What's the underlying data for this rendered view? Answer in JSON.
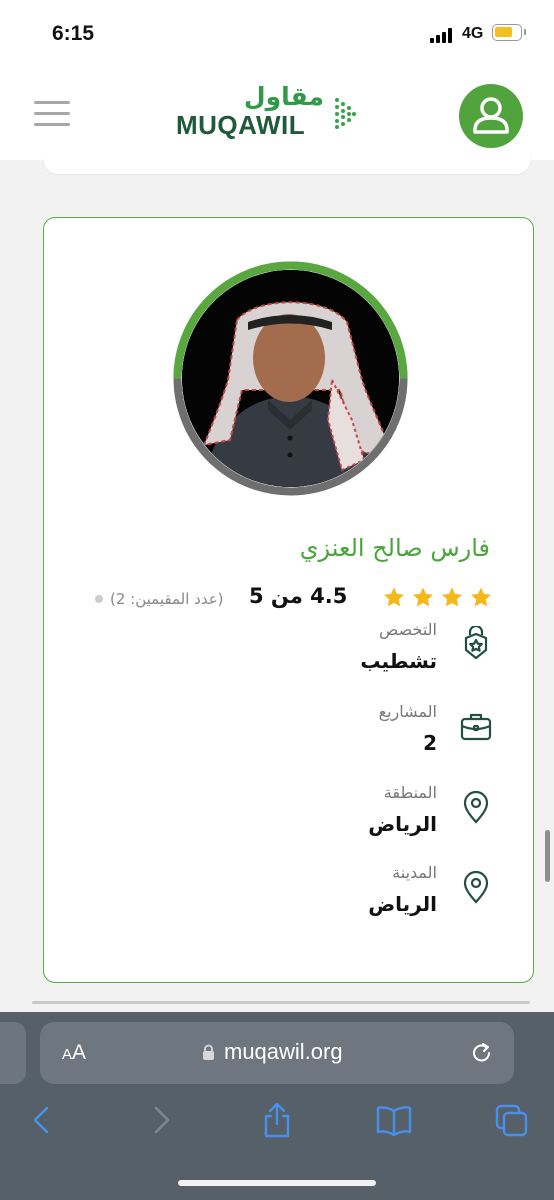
{
  "status_bar": {
    "time": "6:15",
    "network": "4G"
  },
  "header": {
    "logo_arabic": "مقاول",
    "logo_english": "MUQAWIL",
    "menu_icon": "hamburger-menu-icon",
    "account_icon": "user-icon",
    "brand_color": "#51a33e"
  },
  "profile": {
    "name": "فارس صالح العنزي",
    "rating_text": "4.5 من 5",
    "raters_text": "(عدد المقيمين: 2)",
    "stars_count": 4,
    "fields": [
      {
        "label": "التخصص",
        "value": "تشطيب",
        "icon": "specialty-badge-icon"
      },
      {
        "label": "المشاريع",
        "value": "2",
        "icon": "briefcase-icon"
      },
      {
        "label": "المنطقة",
        "value": "الرياض",
        "icon": "location-pin-icon"
      },
      {
        "label": "المدينة",
        "value": "الرياض",
        "icon": "location-pin-icon"
      }
    ]
  },
  "browser": {
    "text_size_label": "AA",
    "url": "muqawil.org",
    "toolbar_icons": [
      "back-icon",
      "forward-icon",
      "share-icon",
      "bookmarks-icon",
      "tabs-icon"
    ]
  }
}
